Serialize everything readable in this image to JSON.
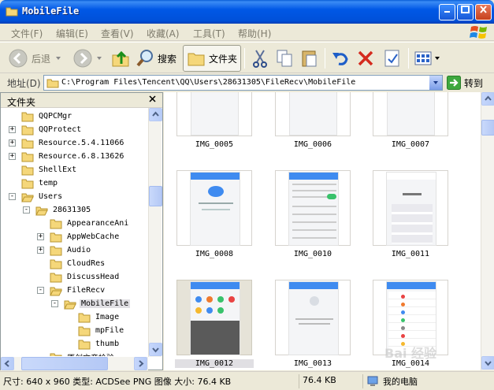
{
  "window": {
    "title": "MobileFile"
  },
  "menu": [
    "文件(F)",
    "编辑(E)",
    "查看(V)",
    "收藏(A)",
    "工具(T)",
    "帮助(H)"
  ],
  "toolbar": {
    "back": "后退",
    "search": "搜索",
    "folders": "文件夹"
  },
  "address": {
    "label": "地址(D)",
    "path": "C:\\Program Files\\Tencent\\QQ\\Users\\28631305\\FileRecv\\MobileFile",
    "go": "转到"
  },
  "panel": {
    "title": "文件夹"
  },
  "tree": [
    {
      "name": "QQPCMgr",
      "level": 0,
      "expander": ""
    },
    {
      "name": "QQProtect",
      "level": 0,
      "expander": "+"
    },
    {
      "name": "Resource.5.4.11066",
      "level": 0,
      "expander": "+"
    },
    {
      "name": "Resource.6.8.13626",
      "level": 0,
      "expander": "+"
    },
    {
      "name": "ShellExt",
      "level": 0,
      "expander": ""
    },
    {
      "name": "temp",
      "level": 0,
      "expander": ""
    },
    {
      "name": "Users",
      "level": 0,
      "expander": "-"
    },
    {
      "name": "28631305",
      "level": 1,
      "expander": "-"
    },
    {
      "name": "AppearanceAni",
      "level": 2,
      "expander": ""
    },
    {
      "name": "AppWebCache",
      "level": 2,
      "expander": "+"
    },
    {
      "name": "Audio",
      "level": 2,
      "expander": "+"
    },
    {
      "name": "CloudRes",
      "level": 2,
      "expander": ""
    },
    {
      "name": "DiscussHead",
      "level": 2,
      "expander": ""
    },
    {
      "name": "FileRecv",
      "level": 2,
      "expander": "-"
    },
    {
      "name": "MobileFile",
      "level": 3,
      "expander": "-",
      "selected": true
    },
    {
      "name": "Image",
      "level": 4,
      "expander": ""
    },
    {
      "name": "mpFile",
      "level": 4,
      "expander": ""
    },
    {
      "name": "thumb",
      "level": 4,
      "expander": ""
    },
    {
      "name": "原创文章检验",
      "level": 2,
      "expander": ""
    }
  ],
  "files": [
    {
      "name": "IMG_0005"
    },
    {
      "name": "IMG_0006"
    },
    {
      "name": "IMG_0007"
    },
    {
      "name": "IMG_0008"
    },
    {
      "name": "IMG_0010"
    },
    {
      "name": "IMG_0011"
    },
    {
      "name": "IMG_0012",
      "selected": true
    },
    {
      "name": "IMG_0013"
    },
    {
      "name": "IMG_0014"
    }
  ],
  "status": {
    "details": "尺寸: 640 x 960 类型: ACDSee PNG 图像 大小: 76.4 KB",
    "size": "76.4 KB",
    "location": "我的电脑"
  },
  "colors": {
    "titlebar": "#0058E6",
    "selection": "#E0DFE3",
    "folder": "#F5D77A"
  },
  "watermark": "Bai 经验"
}
